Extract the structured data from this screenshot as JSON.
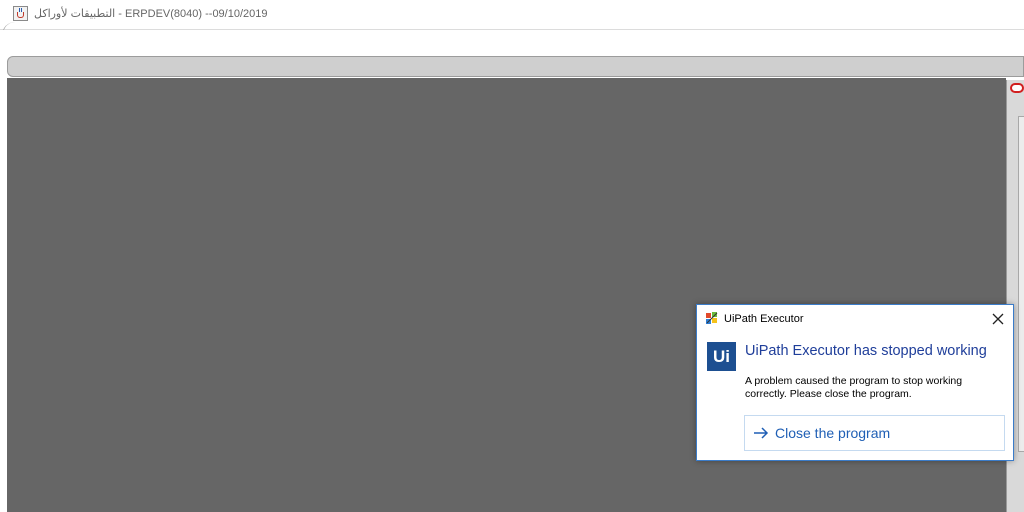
{
  "window": {
    "title": "التطبيقات لأوراكل - ERPDEV(8040) --09/10/2019",
    "app_icon": "java-cup-icon"
  },
  "dialog": {
    "title": "UiPath Executor",
    "title_icon": "windows-error-icon",
    "close_icon": "close-icon",
    "logo_text": "Ui",
    "heading": "UiPath Executor has stopped working",
    "message": "A problem caused the program to stop working correctly. Please close the program.",
    "action_label": "Close the program",
    "action_icon": "arrow-right-icon",
    "accent_color": "#1d4f91",
    "heading_color": "#1f3e9a",
    "link_color": "#1f5fb5"
  },
  "colors": {
    "workspace": "#666666",
    "toolbar_bar": "#cfcfcf",
    "oracle_mark": "#d11f1f"
  }
}
